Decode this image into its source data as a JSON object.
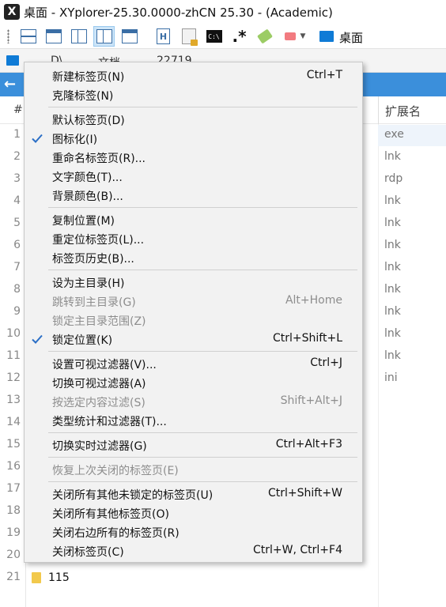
{
  "window": {
    "logo": "X",
    "title": "桌面 - XYplorer-25.30.0000-zhCN 25.30 - (Academic)"
  },
  "toolbar": {
    "location_label": "桌面",
    "icons": [
      "single-pane-icon",
      "dual-pane-horizontal-icon",
      "dual-pane-vertical-icon",
      "tree-pane-icon",
      "info-panel-icon",
      "home-tab-icon",
      "lock-tab-icon",
      "command-prompt-icon",
      "regex-star-icon",
      "tag-icon",
      "color-filter-icon"
    ]
  },
  "tabs": [
    {
      "label": "D\\"
    },
    {
      "label": "文档"
    },
    {
      "label": "22719"
    }
  ],
  "list": {
    "col_hash": "#",
    "col_ext": "扩展名",
    "row_numbers": [
      "1",
      "2",
      "3",
      "4",
      "5",
      "6",
      "7",
      "8",
      "9",
      "10",
      "11",
      "12",
      "13",
      "14",
      "15",
      "16",
      "17",
      "18",
      "19",
      "20",
      "21"
    ],
    "extensions": [
      "exe",
      "lnk",
      "rdp",
      "lnk",
      "lnk",
      "lnk",
      "lnk",
      "lnk",
      "lnk",
      "lnk",
      "lnk",
      "ini"
    ],
    "last_item_name": "115"
  },
  "menu": {
    "items": [
      {
        "label": "新建标签页(N)",
        "shortcut": "Ctrl+T",
        "checked": false,
        "disabled": false
      },
      {
        "label": "克隆标签(N)",
        "shortcut": "",
        "checked": false,
        "disabled": false
      },
      {
        "label": "默认标签页(D)",
        "shortcut": "",
        "checked": false,
        "disabled": false
      },
      {
        "label": "图标化(I)",
        "shortcut": "",
        "checked": true,
        "disabled": false
      },
      {
        "label": "重命名标签页(R)...",
        "shortcut": "",
        "checked": false,
        "disabled": false
      },
      {
        "label": "文字颜色(T)...",
        "shortcut": "",
        "checked": false,
        "disabled": false
      },
      {
        "label": "背景颜色(B)...",
        "shortcut": "",
        "checked": false,
        "disabled": false
      },
      {
        "label": "复制位置(M)",
        "shortcut": "",
        "checked": false,
        "disabled": false
      },
      {
        "label": "重定位标签页(L)...",
        "shortcut": "",
        "checked": false,
        "disabled": false
      },
      {
        "label": "标签页历史(B)...",
        "shortcut": "",
        "checked": false,
        "disabled": false
      },
      {
        "label": "设为主目录(H)",
        "shortcut": "",
        "checked": false,
        "disabled": false
      },
      {
        "label": "跳转到主目录(G)",
        "shortcut": "Alt+Home",
        "checked": false,
        "disabled": true
      },
      {
        "label": "锁定主目录范围(Z)",
        "shortcut": "",
        "checked": false,
        "disabled": true
      },
      {
        "label": "锁定位置(K)",
        "shortcut": "Ctrl+Shift+L",
        "checked": true,
        "disabled": false
      },
      {
        "label": "设置可视过滤器(V)...",
        "shortcut": "Ctrl+J",
        "checked": false,
        "disabled": false
      },
      {
        "label": "切换可视过滤器(A)",
        "shortcut": "",
        "checked": false,
        "disabled": false
      },
      {
        "label": "按选定内容过滤(S)",
        "shortcut": "Shift+Alt+J",
        "checked": false,
        "disabled": true
      },
      {
        "label": "类型统计和过滤器(T)...",
        "shortcut": "",
        "checked": false,
        "disabled": false
      },
      {
        "label": "切换实时过滤器(G)",
        "shortcut": "Ctrl+Alt+F3",
        "checked": false,
        "disabled": false
      },
      {
        "label": "恢复上次关闭的标签页(E)",
        "shortcut": "",
        "checked": false,
        "disabled": true
      },
      {
        "label": "关闭所有其他未锁定的标签页(U)",
        "shortcut": "Ctrl+Shift+W",
        "checked": false,
        "disabled": false
      },
      {
        "label": "关闭所有其他标签页(O)",
        "shortcut": "",
        "checked": false,
        "disabled": false
      },
      {
        "label": "关闭右边所有的标签页(R)",
        "shortcut": "",
        "checked": false,
        "disabled": false
      },
      {
        "label": "关闭标签页(C)",
        "shortcut": "Ctrl+W, Ctrl+F4",
        "checked": false,
        "disabled": false
      }
    ]
  }
}
